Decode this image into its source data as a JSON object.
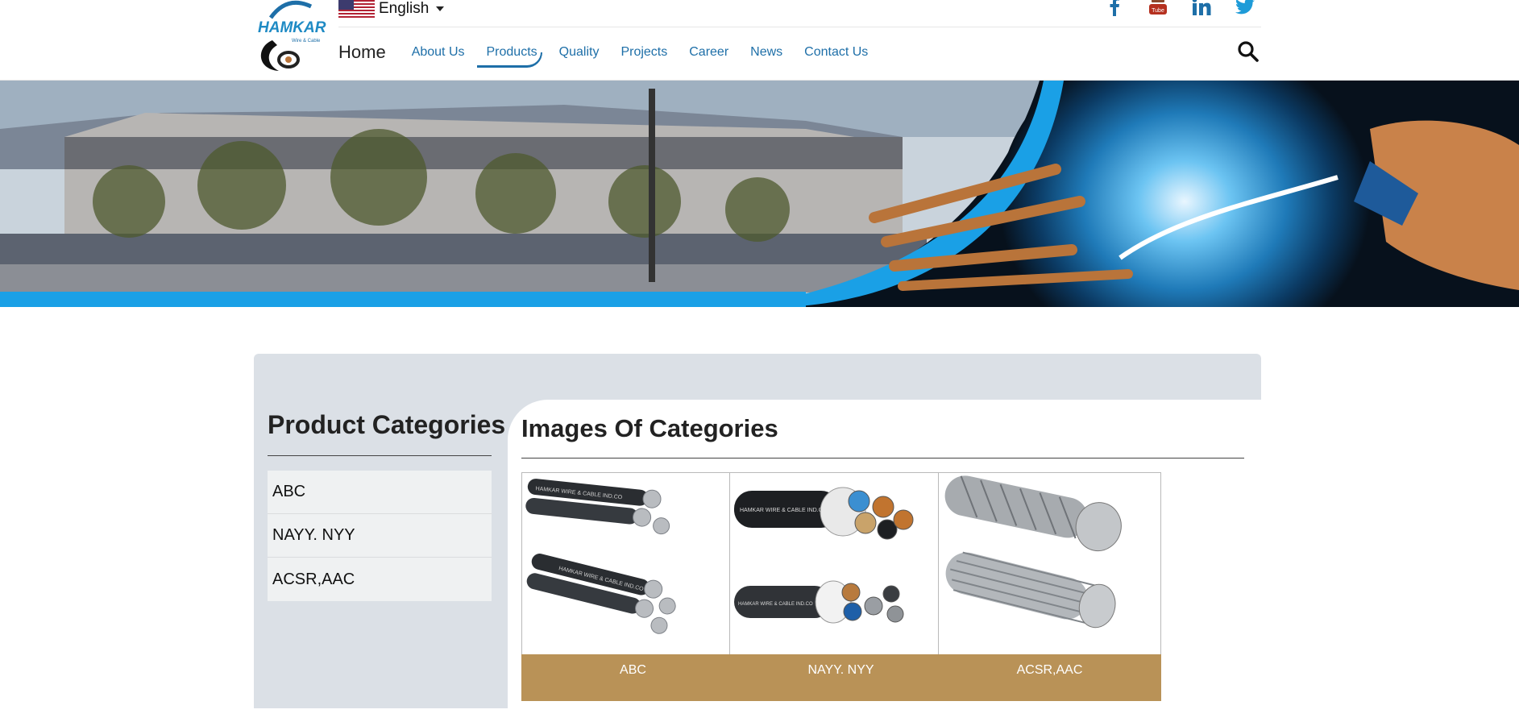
{
  "header": {
    "logo_text": "HAMKAR",
    "logo_subtext": "Wire & Cable",
    "language": {
      "selected": "English",
      "flag_icon": "us-flag-icon"
    },
    "socials": [
      {
        "name": "facebook",
        "icon": "facebook-icon"
      },
      {
        "name": "youtube",
        "icon": "youtube-icon"
      },
      {
        "name": "linkedin",
        "icon": "linkedin-icon"
      },
      {
        "name": "twitter",
        "icon": "twitter-icon"
      }
    ],
    "nav": {
      "home": "Home",
      "about": "About Us",
      "products": "Products",
      "quality": "Quality",
      "projects": "Projects",
      "career": "Career",
      "news": "News",
      "contact": "Contact Us",
      "active": "Products"
    },
    "search_icon": "search-icon"
  },
  "sidebar": {
    "title": "Product Categories",
    "items": [
      {
        "label": "ABC"
      },
      {
        "label": "NAYY. NYY"
      },
      {
        "label": "ACSR,AAC"
      }
    ]
  },
  "main": {
    "title": "Images Of Categories",
    "cards": [
      {
        "label": "ABC",
        "cable_print": "HAMKAR WIRE & CABLE IND.CO"
      },
      {
        "label": "NAYY. NYY",
        "cable_print": "HAMKAR WIRE & CABLE IND.CO"
      },
      {
        "label": "ACSR,AAC"
      }
    ]
  },
  "colors": {
    "brand_blue": "#1e6fa8",
    "card_label_bg": "#b99257",
    "panel_bg": "#dbe0e6",
    "banner_accent": "#1aa0e6"
  }
}
